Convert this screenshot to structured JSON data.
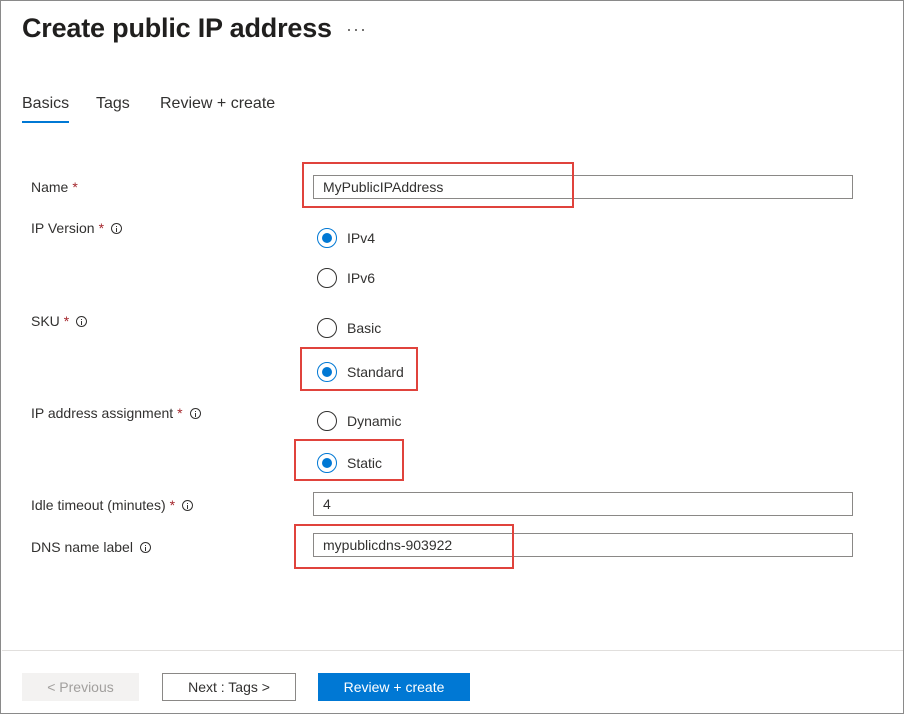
{
  "header": {
    "title": "Create public IP address",
    "more_label": "···"
  },
  "tabs": [
    {
      "label": "Basics",
      "active": true
    },
    {
      "label": "Tags",
      "active": false
    },
    {
      "label": "Review + create",
      "active": false
    }
  ],
  "form": {
    "required_mark": "*",
    "name": {
      "label": "Name",
      "value": "MyPublicIPAddress"
    },
    "ip_version": {
      "label": "IP Version",
      "options": [
        {
          "label": "IPv4",
          "checked": true
        },
        {
          "label": "IPv6",
          "checked": false
        }
      ]
    },
    "sku": {
      "label": "SKU",
      "options": [
        {
          "label": "Basic",
          "checked": false
        },
        {
          "label": "Standard",
          "checked": true
        }
      ]
    },
    "ip_assignment": {
      "label": "IP address assignment",
      "options": [
        {
          "label": "Dynamic",
          "checked": false
        },
        {
          "label": "Static",
          "checked": true
        }
      ]
    },
    "idle_timeout": {
      "label": "Idle timeout (minutes)",
      "value": "4"
    },
    "dns_label": {
      "label": "DNS name label",
      "value": "mypublicdns-903922"
    }
  },
  "footer": {
    "previous": "< Previous",
    "next": "Next : Tags >",
    "review": "Review + create"
  },
  "colors": {
    "accent": "#0078d4",
    "highlight": "#e0433c",
    "required": "#a4262c"
  }
}
